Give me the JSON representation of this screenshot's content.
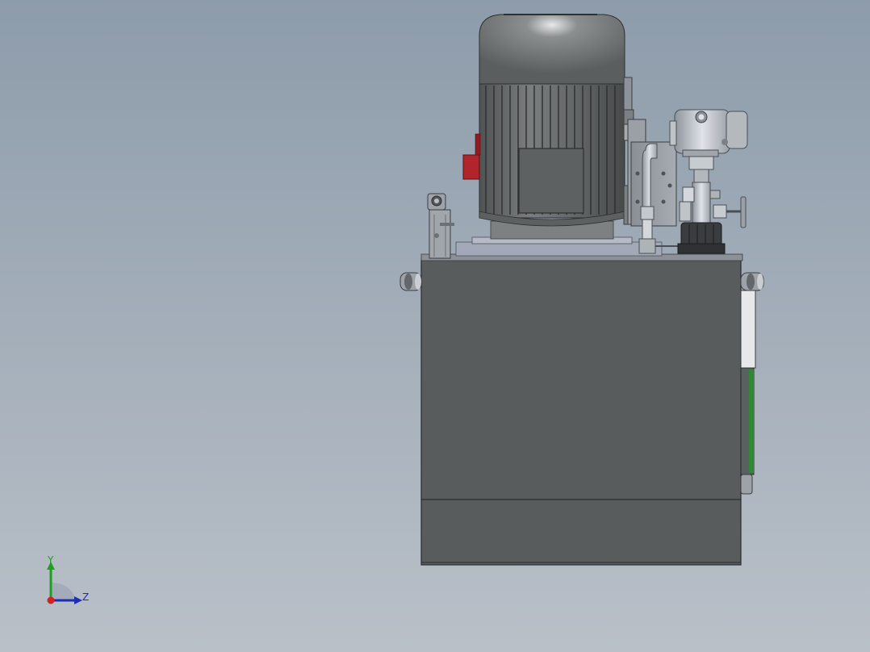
{
  "viewport": {
    "background_top": "#8d9cab",
    "background_bottom": "#b9c0c8"
  },
  "model": {
    "parts": [
      "motor-fan-cover",
      "motor-cooling-fins",
      "motor-terminal-box",
      "motor-flange",
      "valve-block",
      "pressure-gauge",
      "needle-valve",
      "filter-cap",
      "oil-tank",
      "sight-glass",
      "lifting-eye-left",
      "lifting-eye-right",
      "breather-bracket"
    ],
    "colors": {
      "tank": "#585c5d",
      "motor": "#646868",
      "red_plate": "#b2242b",
      "level_gauge_green": "#2f8a34"
    }
  },
  "triad": {
    "y_label": "Y",
    "z_label": "Z",
    "y_color": "#1ea01e",
    "z_color": "#1d2db5",
    "x_color": "#d42020"
  }
}
